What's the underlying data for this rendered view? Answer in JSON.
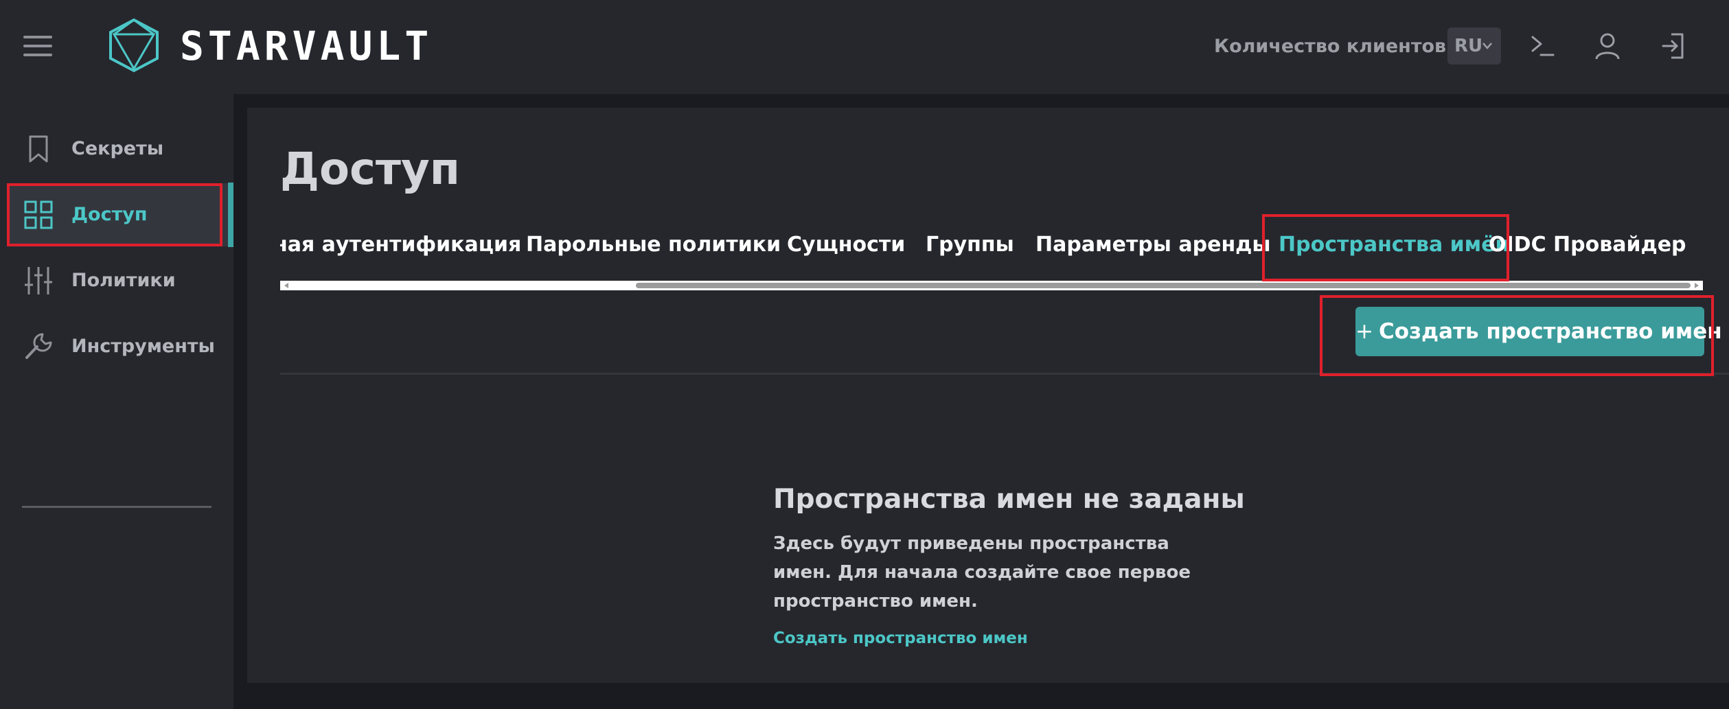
{
  "header": {
    "brand": "STARVAULT",
    "clients_link": "Количество клиентов",
    "language": "RU"
  },
  "sidebar": {
    "items": [
      {
        "label": "Секреты",
        "icon": "bookmark-icon"
      },
      {
        "label": "Доступ",
        "icon": "grid-icon",
        "active": true
      },
      {
        "label": "Политики",
        "icon": "sliders-icon"
      },
      {
        "label": "Инструменты",
        "icon": "wrench-icon"
      }
    ]
  },
  "main": {
    "title": "Доступ",
    "tabs": [
      {
        "label": "ная аутентификация"
      },
      {
        "label": "Парольные политики"
      },
      {
        "label": "Сущности"
      },
      {
        "label": "Группы"
      },
      {
        "label": "Параметры аренды"
      },
      {
        "label": "Пространства имён",
        "active": true
      },
      {
        "label": "OIDC Провайдер"
      }
    ],
    "create_button": "Создать пространство имен",
    "empty_state": {
      "title": "Пространства имен не заданы",
      "description": "Здесь будут приведены пространства имен. Для начала создайте свое первое пространство имен.",
      "link": "Создать пространство имен"
    }
  },
  "colors": {
    "accent": "#4cc7c7",
    "button": "#3a9b9a",
    "highlight": "#e0202c",
    "background": "#1a1b20",
    "panel": "#26272d"
  }
}
